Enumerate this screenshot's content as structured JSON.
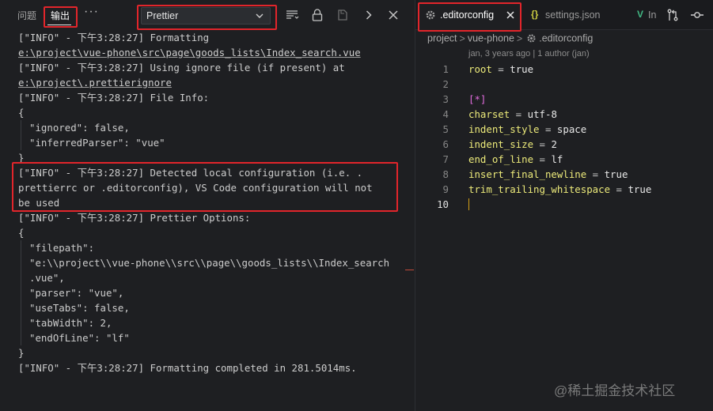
{
  "panel": {
    "tabs": [
      "问题",
      "输出"
    ],
    "more": "···",
    "channel": "Prettier"
  },
  "log": [
    {
      "text": "[\"INFO\" - 下午3:28:27] Formatting"
    },
    {
      "text": "e:\\project\\vue-phone\\src\\page\\goods_lists\\Index_search.vue",
      "style": "underline"
    },
    {
      "text": "[\"INFO\" - 下午3:28:27] Using ignore file (if present) at"
    },
    {
      "text": "e:\\project\\.prettierignore",
      "style": "underline"
    },
    {
      "text": "[\"INFO\" - 下午3:28:27] File Info:"
    },
    {
      "text": "{"
    },
    {
      "text": "\"ignored\": false,",
      "indent": true
    },
    {
      "text": "\"inferredParser\": \"vue\"",
      "indent": true
    },
    {
      "text": "}"
    },
    {
      "text": "[\"INFO\" - 下午3:28:27] Detected local configuration (i.e. ."
    },
    {
      "text": "prettierrc or .editorconfig), VS Code configuration will not"
    },
    {
      "text": "be used"
    },
    {
      "text": "[\"INFO\" - 下午3:28:27] Prettier Options:"
    },
    {
      "text": "{"
    },
    {
      "text": "\"filepath\":",
      "indent": true
    },
    {
      "text": "\"e:\\\\project\\\\vue-phone\\\\src\\\\page\\\\goods_lists\\\\Index_search",
      "indent": true
    },
    {
      "text": ".vue\",",
      "indent": true
    },
    {
      "text": "\"parser\": \"vue\",",
      "indent": true
    },
    {
      "text": "\"useTabs\": false,",
      "indent": true
    },
    {
      "text": "\"tabWidth\": 2,",
      "indent": true
    },
    {
      "text": "\"endOfLine\": \"lf\"",
      "indent": true
    },
    {
      "text": "}"
    },
    {
      "text": "[\"INFO\" - 下午3:28:27] Formatting completed in 281.5014ms."
    }
  ],
  "editor": {
    "tabs": {
      "active": ".editorconfig",
      "second": "settings.json",
      "third": "In"
    },
    "breadcrumb": [
      "project",
      "vue-phone",
      ".editorconfig"
    ],
    "codelens": "jan, 3 years ago | 1 author (jan)",
    "active_line": 10,
    "lines": [
      {
        "n": "1",
        "parts": [
          {
            "t": "root",
            "c": "k"
          },
          {
            "t": " = ",
            "c": "o"
          },
          {
            "t": "true",
            "c": "v"
          }
        ]
      },
      {
        "n": "2",
        "parts": []
      },
      {
        "n": "3",
        "parts": [
          {
            "t": "[*]",
            "c": "s"
          }
        ]
      },
      {
        "n": "4",
        "parts": [
          {
            "t": "charset",
            "c": "k"
          },
          {
            "t": " = ",
            "c": "o"
          },
          {
            "t": "utf-8",
            "c": "v"
          }
        ]
      },
      {
        "n": "5",
        "parts": [
          {
            "t": "indent_style",
            "c": "k"
          },
          {
            "t": " = ",
            "c": "o"
          },
          {
            "t": "space",
            "c": "v"
          }
        ]
      },
      {
        "n": "6",
        "parts": [
          {
            "t": "indent_size",
            "c": "k"
          },
          {
            "t": " = ",
            "c": "o"
          },
          {
            "t": "2",
            "c": "v"
          }
        ]
      },
      {
        "n": "7",
        "parts": [
          {
            "t": "end_of_line",
            "c": "k"
          },
          {
            "t": " = ",
            "c": "o"
          },
          {
            "t": "lf",
            "c": "v"
          }
        ]
      },
      {
        "n": "8",
        "parts": [
          {
            "t": "insert_final_newline",
            "c": "k"
          },
          {
            "t": " = ",
            "c": "o"
          },
          {
            "t": "true",
            "c": "v"
          }
        ]
      },
      {
        "n": "9",
        "parts": [
          {
            "t": "trim_trailing_whitespace",
            "c": "k"
          },
          {
            "t": " = ",
            "c": "o"
          },
          {
            "t": "true",
            "c": "v"
          }
        ]
      },
      {
        "n": "10",
        "parts": []
      }
    ]
  },
  "watermark": "@稀土掘金技术社区",
  "colors": {
    "background": "#1e1f22",
    "highlight": "#e2252b",
    "key": "#ecea7a",
    "section": "#e46de0"
  }
}
